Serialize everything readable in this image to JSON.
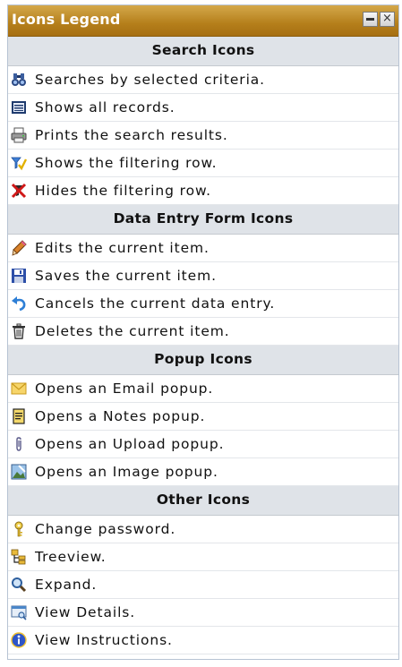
{
  "title": "Icons Legend",
  "window_buttons": {
    "minimize": "–",
    "close": "×"
  },
  "sections": [
    {
      "header": "Search Icons",
      "items": [
        {
          "icon": "binoculars-icon",
          "label": "Searches by selected criteria."
        },
        {
          "icon": "records-icon",
          "label": "Shows all records."
        },
        {
          "icon": "printer-icon",
          "label": "Prints the search results."
        },
        {
          "icon": "show-filter-icon",
          "label": "Shows the filtering row."
        },
        {
          "icon": "hide-filter-icon",
          "label": "Hides the filtering row."
        }
      ]
    },
    {
      "header": "Data Entry Form Icons",
      "items": [
        {
          "icon": "pencil-icon",
          "label": "Edits the current item."
        },
        {
          "icon": "floppy-disk-icon",
          "label": "Saves the current item."
        },
        {
          "icon": "undo-arrow-icon",
          "label": "Cancels the current data entry."
        },
        {
          "icon": "trash-can-icon",
          "label": "Deletes the current item."
        }
      ]
    },
    {
      "header": "Popup Icons",
      "items": [
        {
          "icon": "envelope-icon",
          "label": "Opens an Email popup."
        },
        {
          "icon": "notes-icon",
          "label": "Opens a Notes popup."
        },
        {
          "icon": "paperclip-icon",
          "label": "Opens an Upload popup."
        },
        {
          "icon": "image-icon",
          "label": "Opens an Image popup."
        }
      ]
    },
    {
      "header": "Other Icons",
      "items": [
        {
          "icon": "key-icon",
          "label": "Change password."
        },
        {
          "icon": "treeview-icon",
          "label": "Treeview."
        },
        {
          "icon": "magnifier-icon",
          "label": "Expand."
        },
        {
          "icon": "view-details-icon",
          "label": "View Details."
        },
        {
          "icon": "info-icon",
          "label": "View Instructions."
        }
      ]
    }
  ]
}
